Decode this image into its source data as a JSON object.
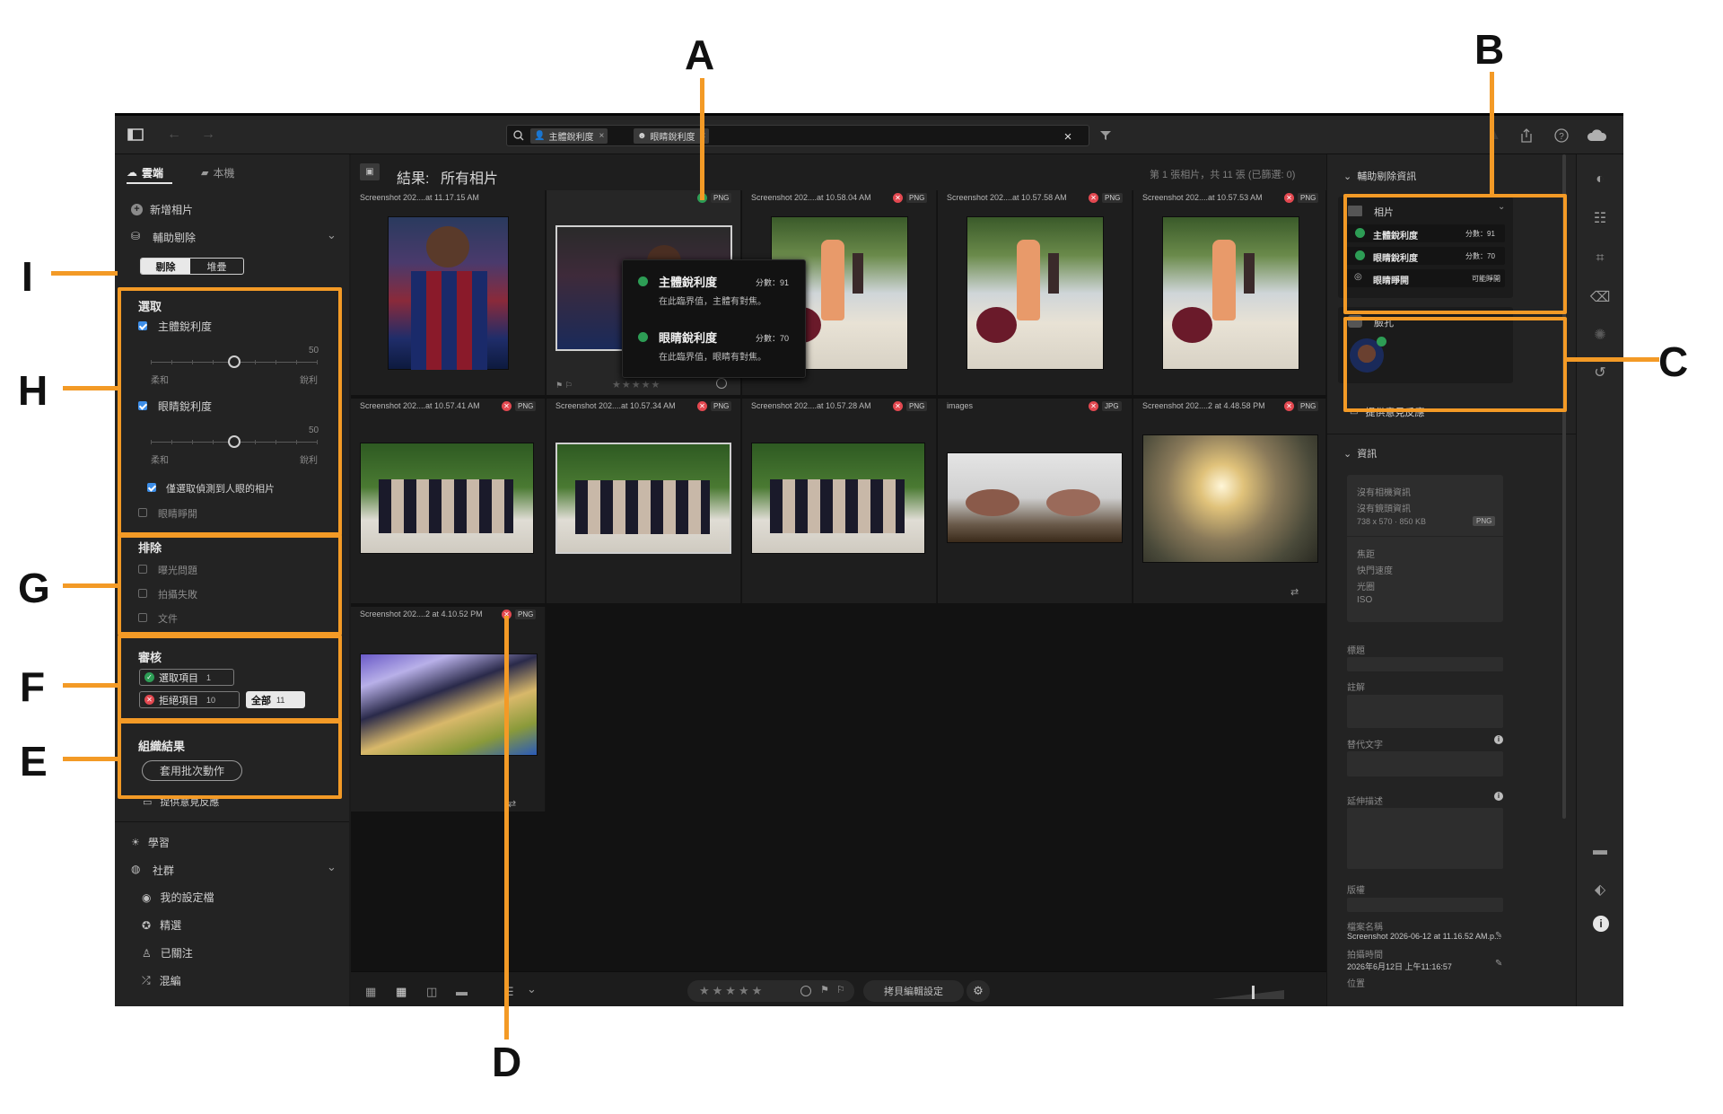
{
  "callouts": {
    "a": "A",
    "b": "B",
    "c": "C",
    "d": "D",
    "e": "E",
    "f": "F",
    "g": "G",
    "h": "H",
    "i": "I"
  },
  "search": {
    "chip1": "主體銳利度",
    "chip2": "眼睛銳利度",
    "close": "×"
  },
  "left": {
    "tab_cloud": "雲端",
    "tab_local": "本機",
    "add_photos": "新增相片",
    "assisted_culling": "輔助剔除",
    "seg_delete": "剔除",
    "seg_stack": "堆疊",
    "select_heading": "選取",
    "subject_sharpness": "主體銳利度",
    "slider_value_1": "50",
    "soft_1": "柔和",
    "sharp_1": "銳利",
    "eye_sharpness": "眼睛銳利度",
    "slider_value_2": "50",
    "soft_2": "柔和",
    "sharp_2": "銳利",
    "only_eyes": "僅選取偵測到人眼的相片",
    "eyes_open": "眼睛睜開",
    "exclude_heading": "排除",
    "exposure": "曝光問題",
    "misfire": "拍攝失敗",
    "document": "文件",
    "review_heading": "審核",
    "selected": "選取項目",
    "selected_count": "1",
    "rejected": "拒絕項目",
    "rejected_count": "10",
    "all": "全部",
    "all_count": "11",
    "organize_heading": "組織結果",
    "apply_batch": "套用批次動作",
    "feedback": "提供意見反應",
    "learn": "學習",
    "community": "社群",
    "profile": "我的設定檔",
    "featured": "精選",
    "following": "已關注",
    "remix": "混編"
  },
  "main": {
    "results_label": "結果:",
    "results_value": "所有相片",
    "count": "第 1 張相片，共 11 張 (已篩選: 0)",
    "row1": [
      {
        "name": "Screenshot 202....at 11.17.15 AM",
        "fmt": "",
        "status": "none"
      },
      {
        "name": "",
        "fmt": "PNG",
        "status": "accept"
      },
      {
        "name": "Screenshot 202....at 10.58.04 AM",
        "fmt": "PNG",
        "status": "reject"
      },
      {
        "name": "Screenshot 202....at 10.57.58 AM",
        "fmt": "PNG",
        "status": "reject"
      },
      {
        "name": "Screenshot 202....at 10.57.53 AM",
        "fmt": "PNG",
        "status": "reject"
      }
    ],
    "row2": [
      {
        "name": "Screenshot 202....at 10.57.41 AM",
        "fmt": "PNG",
        "status": "reject"
      },
      {
        "name": "Screenshot 202....at 10.57.34 AM",
        "fmt": "PNG",
        "status": "reject"
      },
      {
        "name": "Screenshot 202....at 10.57.28 AM",
        "fmt": "PNG",
        "status": "reject"
      },
      {
        "name": "images",
        "fmt": "JPG",
        "status": "reject"
      },
      {
        "name": "Screenshot 202....2 at 4.48.58 PM",
        "fmt": "PNG",
        "status": "reject"
      }
    ],
    "row3": [
      {
        "name": "Screenshot 202....2 at 4.10.52 PM",
        "fmt": "PNG",
        "status": "reject"
      }
    ],
    "copy_edit": "拷貝編輯設定"
  },
  "tooltip": {
    "t1": "主體銳利度",
    "s1": "分數：91",
    "d1": "在此臨界值，主體有對焦。",
    "t2": "眼睛銳利度",
    "s2": "分數：70",
    "d2": "在此臨界值，眼睛有對焦。"
  },
  "right": {
    "assist_info": "輔助剔除資訊",
    "photo": "相片",
    "c1_label": "主體銳利度",
    "c1_score": "分數：91",
    "c2_label": "眼睛銳利度",
    "c2_score": "分數：70",
    "c3_label": "眼睛睜開",
    "c3_score": "可能睜開",
    "face": "臉孔",
    "feedback": "提供意見反應",
    "info": "資訊",
    "no_camera": "沒有相機資訊",
    "no_lens": "沒有鏡頭資訊",
    "dims": "738 x 570 · 850 KB",
    "fmt": "PNG",
    "focal": "焦距",
    "shutter": "快門速度",
    "aperture": "光圈",
    "iso": "ISO",
    "title": "標題",
    "caption": "註解",
    "alt": "替代文字",
    "extended": "延伸描述",
    "copyright": "版權",
    "filename_label": "檔案名稱",
    "filename": "Screenshot 2026-06-12 at 11.16.52 AM.p...",
    "capture_label": "拍攝時間",
    "capture": "2026年6月12日 上午11:16:57",
    "location": "位置"
  },
  "colors": {
    "accent": "#f39a26",
    "accept": "#2d9d55",
    "reject": "#e34850",
    "check": "#3d8ee8"
  }
}
